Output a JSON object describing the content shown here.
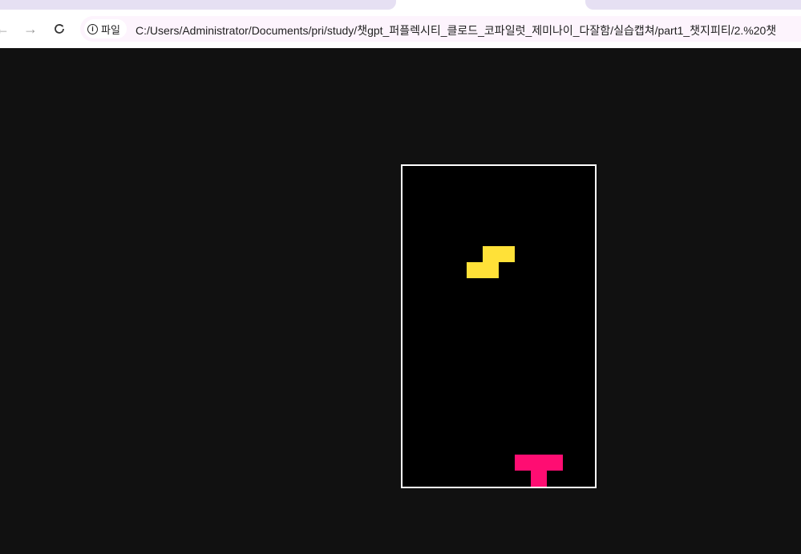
{
  "browser": {
    "security_label": "파일",
    "url": "C:/Users/Administrator/Documents/pri/study/챗gpt_퍼플렉시티_클로드_코파일럿_제미나이_다잘함/실습캡쳐/part1_챗지피티/2.%20챗"
  },
  "game": {
    "board_cols": 12,
    "board_rows": 20,
    "pieces": [
      {
        "name": "active-piece-s",
        "color": "#ffe138",
        "cells": [
          [
            5,
            5
          ],
          [
            6,
            5
          ],
          [
            4,
            6
          ],
          [
            5,
            6
          ]
        ]
      },
      {
        "name": "landed-piece-t",
        "color": "#ff0d72",
        "cells": [
          [
            7,
            18
          ],
          [
            8,
            18
          ],
          [
            9,
            18
          ],
          [
            8,
            19
          ]
        ]
      }
    ]
  }
}
